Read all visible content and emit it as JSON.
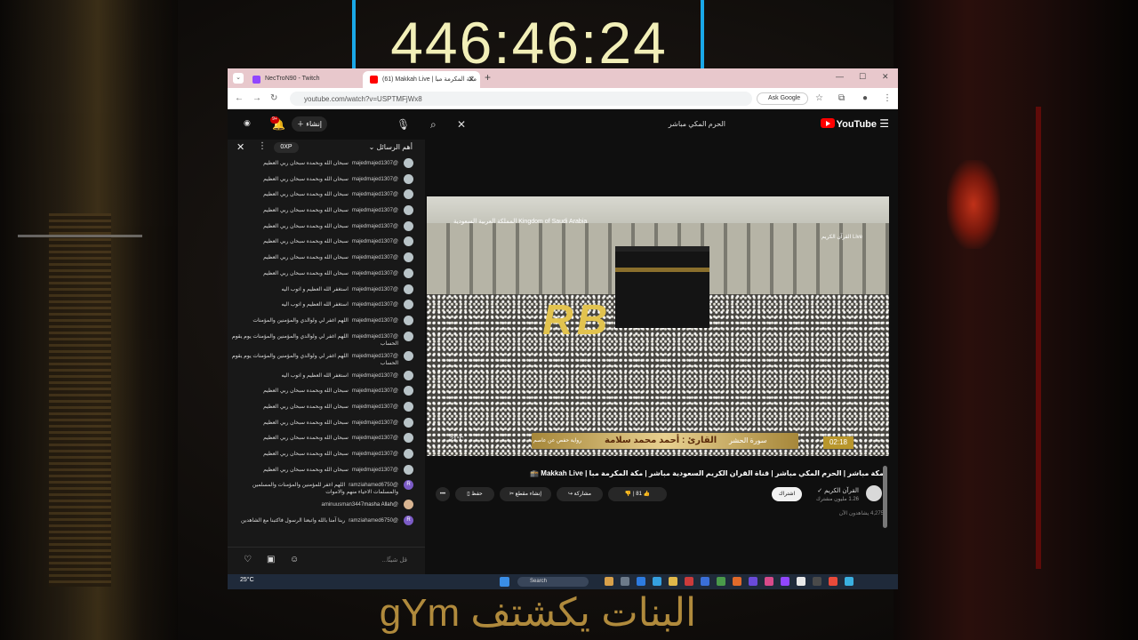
{
  "overlay": {
    "timer": "446:46:24",
    "caption": "البنات يكشتف gYm"
  },
  "browser": {
    "tabs": [
      {
        "label": "NecTroN90 - Twitch",
        "icon": "twitch-icon"
      },
      {
        "label": "(61) Makkah Live | مكة المكرمة مبا",
        "icon": "youtube-icon"
      }
    ],
    "url": "youtube.com/watch?v=USPTMFjWx8",
    "ask_google": "Ask Google"
  },
  "youtube": {
    "logo_text": "YouTube",
    "search_query": "الحرم المكي مباشر",
    "create_label": "إنشاء",
    "notification_count": "9+"
  },
  "chat": {
    "title": "أهم الرسائل",
    "xp": "0XP",
    "input_placeholder": "قل شيئًا...",
    "messages": [
      {
        "user": "@majedmajed1307",
        "text": "سبحان الله وبحمده سبحان ربي العظيم",
        "avatar": "flag"
      },
      {
        "user": "@majedmajed1307",
        "text": "سبحان الله وبحمده سبحان ربي العظيم",
        "avatar": "flag"
      },
      {
        "user": "@majedmajed1307",
        "text": "سبحان الله وبحمده سبحان ربي العظيم",
        "avatar": "flag"
      },
      {
        "user": "@majedmajed1307",
        "text": "سبحان الله وبحمده سبحان ربي العظيم",
        "avatar": "flag"
      },
      {
        "user": "@majedmajed1307",
        "text": "سبحان الله وبحمده سبحان ربي العظيم",
        "avatar": "flag"
      },
      {
        "user": "@majedmajed1307",
        "text": "سبحان الله وبحمده سبحان ربي العظيم",
        "avatar": "flag"
      },
      {
        "user": "@majedmajed1307",
        "text": "سبحان الله وبحمده سبحان ربي العظيم",
        "avatar": "flag"
      },
      {
        "user": "@majedmajed1307",
        "text": "سبحان الله وبحمده سبحان ربي العظيم",
        "avatar": "flag"
      },
      {
        "user": "@majedmajed1307",
        "text": "استغفر الله العظيم و اتوب اليه",
        "avatar": "flag"
      },
      {
        "user": "@majedmajed1307",
        "text": "استغفر الله العظيم و اتوب اليه",
        "avatar": "flag"
      },
      {
        "user": "@majedmajed1307",
        "text": "اللهم اغفر لي ولوالدي والمؤمنين والمؤمنات",
        "avatar": "flag"
      },
      {
        "user": "@majedmajed1307",
        "text": "اللهم اغفر لي ولوالدي والمؤمنين والمؤمنات يوم يقوم الحساب",
        "avatar": "flag"
      },
      {
        "user": "@majedmajed1307",
        "text": "اللهم اغفر لي ولوالدي والمؤمنين والمؤمنات يوم يقوم الحساب",
        "avatar": "flag"
      },
      {
        "user": "@majedmajed1307",
        "text": "استغفر الله العظيم و اتوب اليه",
        "avatar": "flag"
      },
      {
        "user": "@majedmajed1307",
        "text": "سبحان الله وبحمده سبحان ربي العظيم",
        "avatar": "flag"
      },
      {
        "user": "@majedmajed1307",
        "text": "سبحان الله وبحمده سبحان ربي العظيم",
        "avatar": "flag"
      },
      {
        "user": "@majedmajed1307",
        "text": "سبحان الله وبحمده سبحان ربي العظيم",
        "avatar": "flag"
      },
      {
        "user": "@majedmajed1307",
        "text": "سبحان الله وبحمده سبحان ربي العظيم",
        "avatar": "flag"
      },
      {
        "user": "@majedmajed1307",
        "text": "سبحان الله وبحمده سبحان ربي العظيم",
        "avatar": "flag"
      },
      {
        "user": "@majedmajed1307",
        "text": "سبحان الله وبحمده سبحان ربي العظيم",
        "avatar": "flag"
      },
      {
        "user": "@ramziahamed6750",
        "text": "اللهم اغفر للمؤمنين والمؤمنات والمسلمين والمسلمات الاحياء منهم والاموات",
        "avatar": "R"
      },
      {
        "user": "@aminuusman3447",
        "text": "masha Allah",
        "avatar": "photo"
      },
      {
        "user": "@ramziahamed6750",
        "text": "ربنا آمنا بالله واتبعنا الرسول فاكتبنا مع الشاهدين",
        "avatar": "R"
      }
    ]
  },
  "video": {
    "overlay_country": "المملكة العربية السعودية Kingdom of Saudi Arabia",
    "overlay_channel": "القرآن الكريم Live",
    "watermark": "RB",
    "reader": "القارئ : أحمد محمد سلامة",
    "surah": "سورة الحشر",
    "riwaya": "رواية حفص عن عاصم",
    "temperature": "21°C",
    "time": "02:18",
    "title": "مكة مباشر | الحرم المكي مباشر | قناة القران الكريم السعودية مباشر | مكة المكرمة مبا | Makkah Live 🕋",
    "channel_name": "القرآن الكريم",
    "channel_subs": "1.26 مليون مشترك",
    "subscribe_label": "اشتراك",
    "like_count": "81",
    "share_label": "مشاركة",
    "clip_label": "إنشاء مقطع",
    "save_label": "حفظ",
    "more_label": "•••",
    "stats": "4,275 يشاهدون الآن"
  },
  "taskbar": {
    "weather": "25°C",
    "search": "Search"
  }
}
